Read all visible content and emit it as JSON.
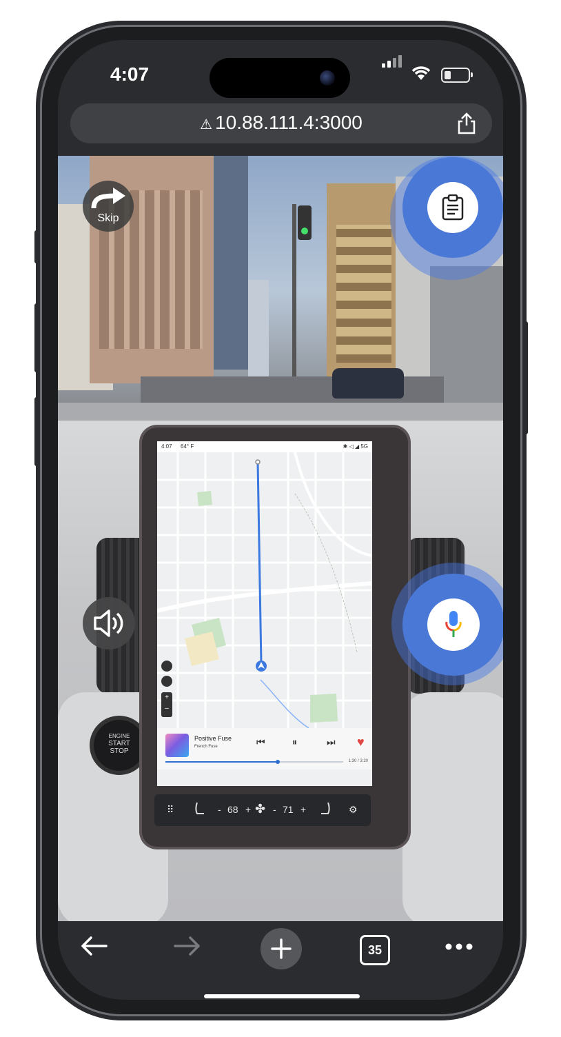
{
  "status_bar": {
    "time": "4:07"
  },
  "browser": {
    "url": "10.88.111.4:3000",
    "tab_count": "35"
  },
  "overlay": {
    "skip_label": "Skip"
  },
  "car_screen": {
    "status_time": "4:07",
    "status_temp": "64° F",
    "status_icons": "✱ ◁ ◢ 5G",
    "media": {
      "song": "Positive Fuse",
      "artist": "French Fuse",
      "progress_fraction": 0.63,
      "time": "1:30 / 3:20"
    },
    "climate": {
      "driver_temp": "68",
      "passenger_temp": "71",
      "minus": "-",
      "plus": "+"
    }
  },
  "dashboard": {
    "engine_line1": "ENGINE",
    "engine_line2": "START",
    "engine_line3": "STOP"
  },
  "colors": {
    "accent_blue": "#4a78d6",
    "route_blue": "#3b78e0",
    "heart_red": "#e04642"
  }
}
